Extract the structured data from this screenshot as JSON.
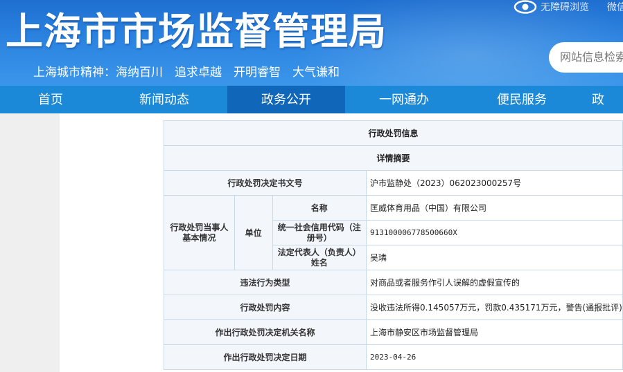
{
  "header": {
    "site_title": "上海市市场监督管理局",
    "slogan": "上海城市精神：海纳百川　追求卓越　开明睿智　大气谦和",
    "accessibility": "无障碍浏览",
    "wechat": "微信",
    "search_placeholder": "网站信息检索"
  },
  "nav": {
    "items": [
      "首页",
      "新闻动态",
      "政务公开",
      "一网通办",
      "便民服务",
      "政"
    ],
    "active": "政务公开"
  },
  "table": {
    "title": "行政处罚信息",
    "subtitle": "详情摘要",
    "rows": {
      "doc_no_label": "行政处罚决定书文号",
      "doc_no_value": "沪市监静处（2023）062023000257号",
      "party_label": "行政处罚当事人基本情况",
      "unit_label": "单位",
      "name_label": "名称",
      "name_value": "匡威体育用品（中国）有限公司",
      "credit_code_label": "统一社会信用代码（注册号）",
      "credit_code_value": "913100006778500660X",
      "legal_rep_label": "法定代表人（负责人）姓名",
      "legal_rep_value": "吴璘",
      "violation_type_label": "违法行为类型",
      "violation_type_value": "对商品或者服务作引人误解的虚假宣传的",
      "penalty_content_label": "行政处罚内容",
      "penalty_content_value": "没收违法所得0.145057万元，罚款0.435171万元，警告(通报批评)",
      "authority_label": "作出行政处罚决定机关名称",
      "authority_value": "上海市静安区市场监督管理局",
      "decision_date_label": "作出行政处罚决定日期",
      "decision_date_value": "2023-04-26"
    }
  }
}
